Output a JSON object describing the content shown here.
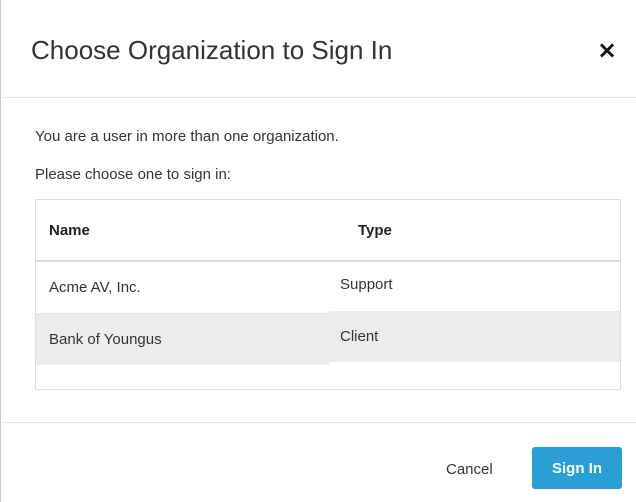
{
  "dialog": {
    "title": "Choose Organization to Sign In",
    "close_label": "×"
  },
  "body": {
    "message": "You are a user in more than one organization.",
    "prompt": "Please choose one to sign in:"
  },
  "table": {
    "headers": {
      "name": "Name",
      "type": "Type"
    },
    "rows": [
      {
        "name": "Acme AV, Inc.",
        "type": "Support"
      },
      {
        "name": "Bank of Youngus",
        "type": "Client"
      }
    ]
  },
  "footer": {
    "cancel_label": "Cancel",
    "signin_label": "Sign In"
  },
  "colors": {
    "primary_button": "#2a9fd6",
    "selected_row": "#ececec"
  },
  "icons": {
    "close": "close-icon"
  }
}
